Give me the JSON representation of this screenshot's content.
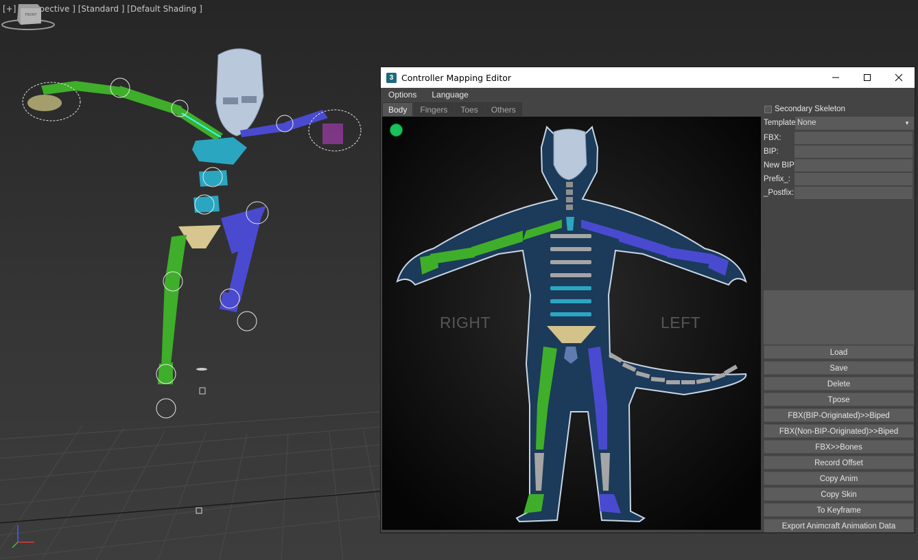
{
  "viewport": {
    "label": "[+] [Perspective ] [Standard ] [Default Shading ]",
    "viewcube_label": "FRONT"
  },
  "window": {
    "title": "Controller Mapping Editor",
    "icon_label": "3"
  },
  "menu": [
    "Options",
    "Language"
  ],
  "tabs": [
    {
      "label": "Body",
      "active": true
    },
    {
      "label": "Fingers",
      "active": false
    },
    {
      "label": "Toes",
      "active": false
    },
    {
      "label": "Others",
      "active": false
    }
  ],
  "canvas": {
    "right_label": "RIGHT",
    "left_label": "LEFT"
  },
  "panel": {
    "secondary_skeleton_label": "Secondary Skeleton",
    "template": {
      "label": "Template",
      "value": "None"
    },
    "fields": [
      {
        "label": "FBX:",
        "value": ""
      },
      {
        "label": "BIP:",
        "value": ""
      },
      {
        "label": "New BIP:",
        "value": ""
      },
      {
        "label": "Prefix_:",
        "value": ""
      },
      {
        "label": "_Postfix:",
        "value": ""
      }
    ],
    "buttons": [
      "Load",
      "Save",
      "Delete",
      "Tpose",
      "FBX(BIP-Originated)>>Biped",
      "FBX(Non-BIP-Originated)>>Biped",
      "FBX>>Bones",
      "Record Offset",
      "Copy Anim",
      "Copy Skin",
      "To Keyframe",
      "Export Animcraft Animation Data"
    ]
  },
  "colors": {
    "right_side": "#3fae2a",
    "left_side": "#4a4ad0",
    "spine": "#2aa6c0",
    "pelvis": "#c9b27a",
    "body_silhouette": "#1c3a5a",
    "status_dot": "#19c15a"
  }
}
